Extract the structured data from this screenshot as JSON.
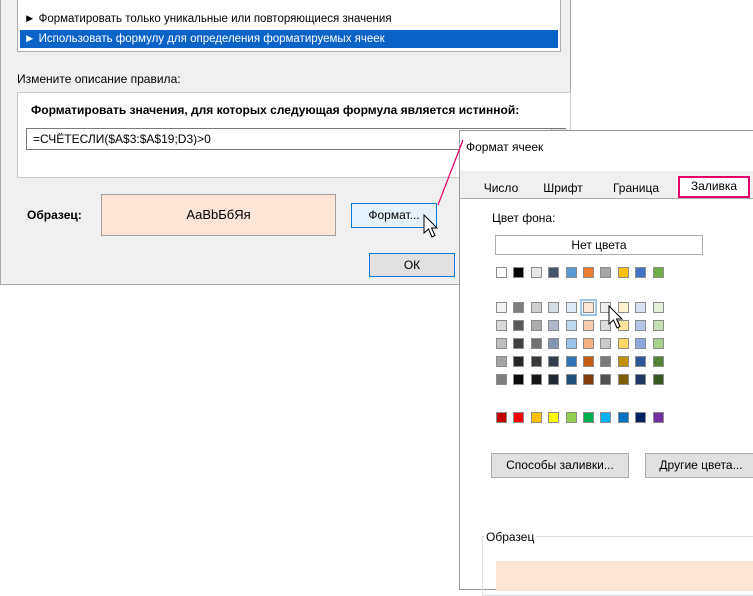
{
  "rule_dialog": {
    "rule_types": [
      "► Форматировать только уникальные или повторяющиеся значения",
      "► Использовать формулу для определения форматируемых ячеек"
    ],
    "edit_description_label": "Измените описание правила:",
    "formula_group_title": "Форматировать значения, для которых следующая формула является истинной:",
    "formula_value": "=СЧЁТЕСЛИ($A$3:$A$19;D3)>0",
    "sample_label": "Образец:",
    "sample_text": "АаВbБбЯя",
    "format_button": "Формат...",
    "ok_button": "ОК"
  },
  "format_dialog": {
    "title": "Формат ячеек",
    "tabs": [
      "Число",
      "Шрифт",
      "Граница",
      "Заливка"
    ],
    "active_tab": "Заливка",
    "bg_color_label": "Цвет фона:",
    "no_color_button": "Нет цвета",
    "fill_effects_button": "Способы заливки...",
    "more_colors_button": "Другие цвета...",
    "sample_label": "Образец",
    "sample_fill_color": "#fce4d6"
  },
  "palette": {
    "theme_row": [
      "#ffffff",
      "#000000",
      "#e7e6e6",
      "#44546a",
      "#5b9bd5",
      "#ed7d31",
      "#a5a5a5",
      "#ffc000",
      "#4472c4",
      "#70ad47"
    ],
    "tints": [
      [
        "#f2f2f2",
        "#7f7f7f",
        "#d0cece",
        "#d6dce4",
        "#deebf6",
        "#fbe5d5",
        "#ededed",
        "#fff2cc",
        "#d9e2f3",
        "#e2efd9"
      ],
      [
        "#d8d8d8",
        "#595959",
        "#aeabab",
        "#adb9ca",
        "#bdd7ee",
        "#f7cbac",
        "#dbdbdb",
        "#fee599",
        "#b4c6e7",
        "#c5e0b3"
      ],
      [
        "#bfbfbf",
        "#3f3f3f",
        "#757070",
        "#8496b0",
        "#9cc3e5",
        "#f4b183",
        "#c9c9c9",
        "#ffd965",
        "#8eaadb",
        "#a8d08d"
      ],
      [
        "#a5a5a5",
        "#262626",
        "#3a3838",
        "#323f4f",
        "#2e75b5",
        "#c55a11",
        "#7b7b7b",
        "#bf9000",
        "#2f5496",
        "#538135"
      ],
      [
        "#7f7f7f",
        "#0c0c0c",
        "#171616",
        "#222a35",
        "#1e4e79",
        "#833c0b",
        "#525252",
        "#7f6000",
        "#1f3864",
        "#375623"
      ]
    ],
    "standard_row": [
      "#c00000",
      "#ff0000",
      "#ffc000",
      "#ffff00",
      "#92d050",
      "#00b050",
      "#00b0f0",
      "#0070c0",
      "#002060",
      "#7030a0"
    ],
    "highlight_accent": "#e2006b"
  }
}
